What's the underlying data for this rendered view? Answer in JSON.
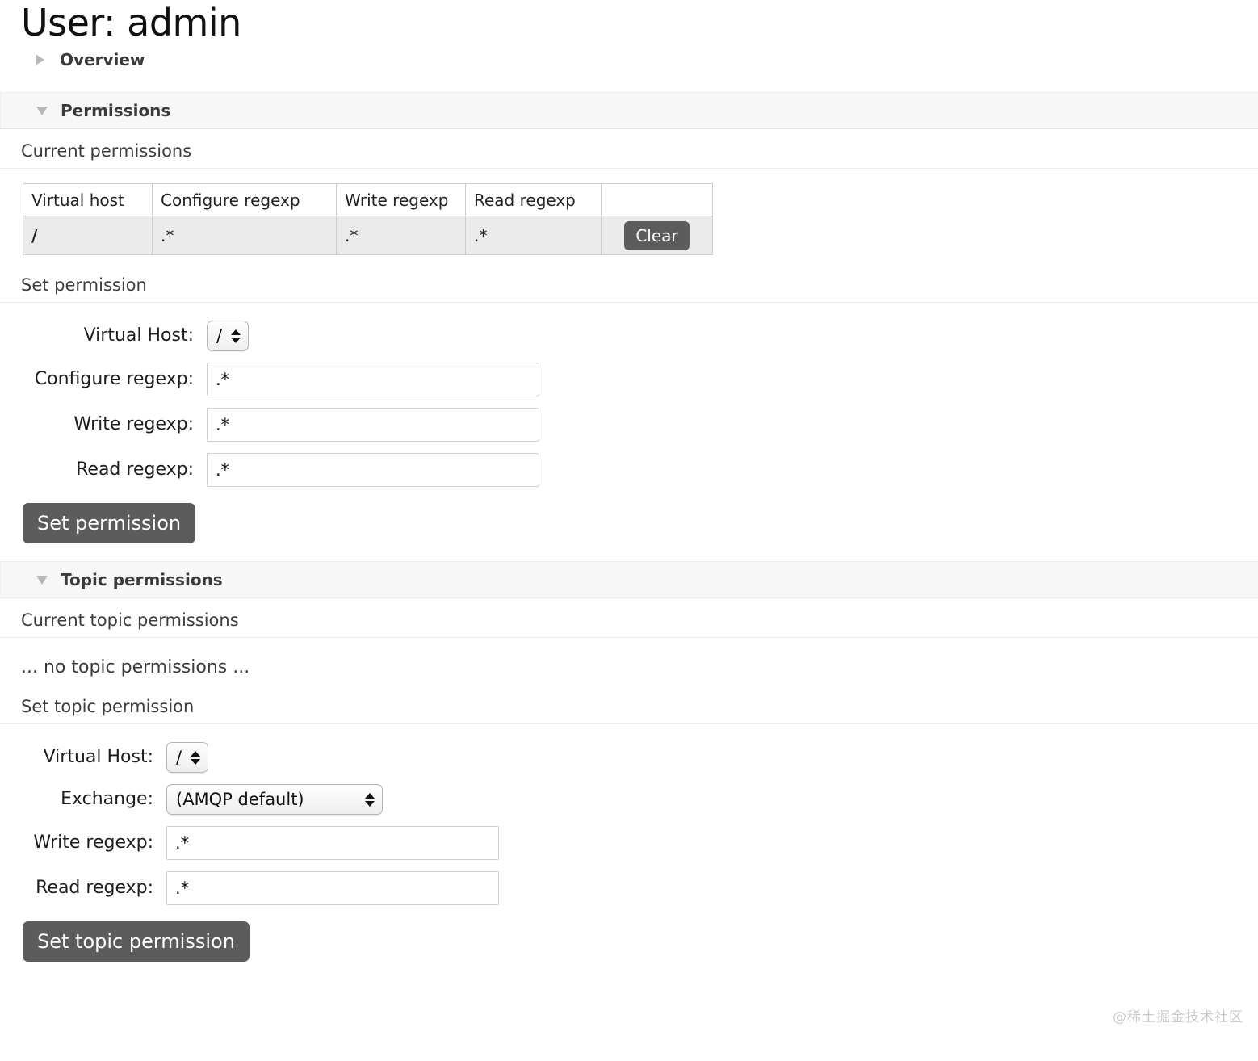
{
  "page": {
    "title": "User: admin"
  },
  "sections": {
    "overview": {
      "label": "Overview",
      "state": "collapsed",
      "toggle_icon": "triangle-right-icon"
    },
    "permissions": {
      "label": "Permissions",
      "state": "expanded",
      "toggle_icon": "triangle-down-icon"
    },
    "topic_permissions": {
      "label": "Topic permissions",
      "state": "expanded",
      "toggle_icon": "triangle-down-icon"
    }
  },
  "current_permissions": {
    "heading": "Current permissions",
    "columns": [
      "Virtual host",
      "Configure regexp",
      "Write regexp",
      "Read regexp",
      ""
    ],
    "rows": [
      {
        "virtual_host": "/",
        "configure_regexp": ".*",
        "write_regexp": ".*",
        "read_regexp": ".*",
        "action_label": "Clear"
      }
    ]
  },
  "set_permission": {
    "heading": "Set permission",
    "labels": {
      "virtual_host": "Virtual Host:",
      "configure_regexp": "Configure regexp:",
      "write_regexp": "Write regexp:",
      "read_regexp": "Read regexp:"
    },
    "values": {
      "virtual_host": "/",
      "configure_regexp": ".*",
      "write_regexp": ".*",
      "read_regexp": ".*"
    },
    "placeholders": {
      "configure_regexp": ".*",
      "write_regexp": ".*",
      "read_regexp": ".*"
    },
    "submit_label": "Set permission"
  },
  "current_topic_permissions": {
    "heading": "Current topic permissions",
    "empty_message": "... no topic permissions ..."
  },
  "set_topic_permission": {
    "heading": "Set topic permission",
    "labels": {
      "virtual_host": "Virtual Host:",
      "exchange": "Exchange:",
      "write_regexp": "Write regexp:",
      "read_regexp": "Read regexp:"
    },
    "values": {
      "virtual_host": "/",
      "exchange": "(AMQP default)",
      "write_regexp": ".*",
      "read_regexp": ".*"
    },
    "placeholders": {
      "write_regexp": ".*",
      "read_regexp": ".*"
    },
    "submit_label": "Set topic permission"
  },
  "watermark": {
    "text": "@稀土掘金技术社区"
  },
  "colors": {
    "button_bg": "#5c5c5c",
    "button_text": "#ffffff",
    "section_band_bg": "#f7f7f7",
    "table_row_bg": "#eaeaea",
    "table_border": "#cccccc",
    "triangle": "#b8b8b8"
  }
}
